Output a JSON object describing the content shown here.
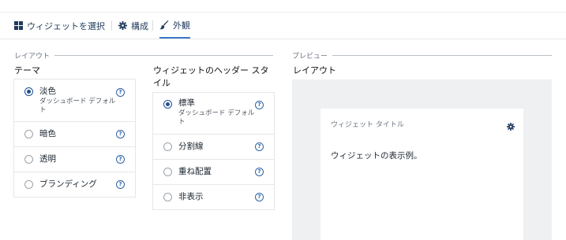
{
  "tabs": [
    {
      "label": "ウィジェットを選択",
      "icon": "grid-icon",
      "active": false
    },
    {
      "label": "構成",
      "icon": "gear-icon",
      "active": false
    },
    {
      "label": "外観",
      "icon": "paintbrush-icon",
      "active": true
    }
  ],
  "layout_section": {
    "title": "レイアウト"
  },
  "theme": {
    "label": "テーマ",
    "options": [
      {
        "label": "淡色",
        "sublabel": "ダッシュボード デフォルト",
        "selected": true
      },
      {
        "label": "暗色",
        "selected": false
      },
      {
        "label": "透明",
        "selected": false
      },
      {
        "label": "ブランディング",
        "selected": false
      }
    ]
  },
  "header_style": {
    "label": "ウィジェットのヘッダー スタイル",
    "options": [
      {
        "label": "標準",
        "sublabel": "ダッシュボード デフォルト",
        "selected": true
      },
      {
        "label": "分割線",
        "selected": false
      },
      {
        "label": "重ね配置",
        "selected": false
      },
      {
        "label": "非表示",
        "selected": false
      }
    ]
  },
  "preview": {
    "section_title": "プレビュー",
    "layout_label": "レイアウト",
    "widget_title": "ウィジェット タイトル",
    "widget_body": "ウィジェットの表示例。"
  },
  "help_glyph": "?",
  "colors": {
    "accent": "#3b78c2",
    "tab_text": "#1f3a5c",
    "preview_bg": "#eef0f2"
  }
}
